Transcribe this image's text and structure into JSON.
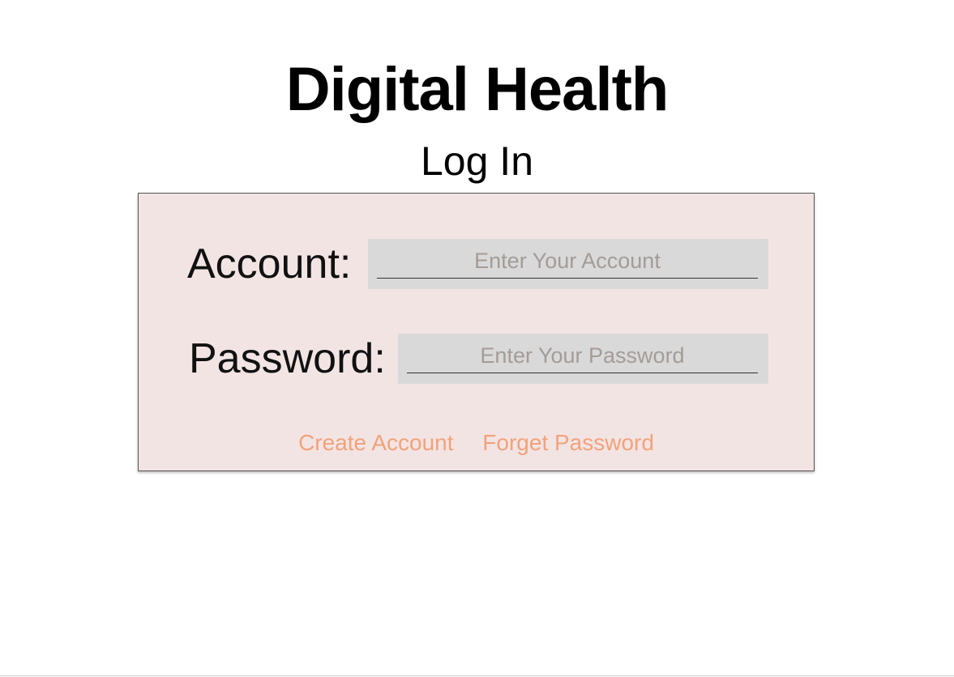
{
  "header": {
    "app_title": "Digital Health",
    "page_subtitle": "Log In"
  },
  "login_form": {
    "account": {
      "label": "Account:",
      "value": "",
      "placeholder": "Enter Your Account"
    },
    "password": {
      "label": "Password:",
      "value": "",
      "placeholder": "Enter Your Password"
    },
    "links": {
      "create_account": "Create Account",
      "forget_password": "Forget Password"
    }
  },
  "colors": {
    "panel_background": "#f3e4e4",
    "input_background": "#d9d9d9",
    "link_color": "#f2a27a",
    "placeholder_color": "#a39c98"
  }
}
